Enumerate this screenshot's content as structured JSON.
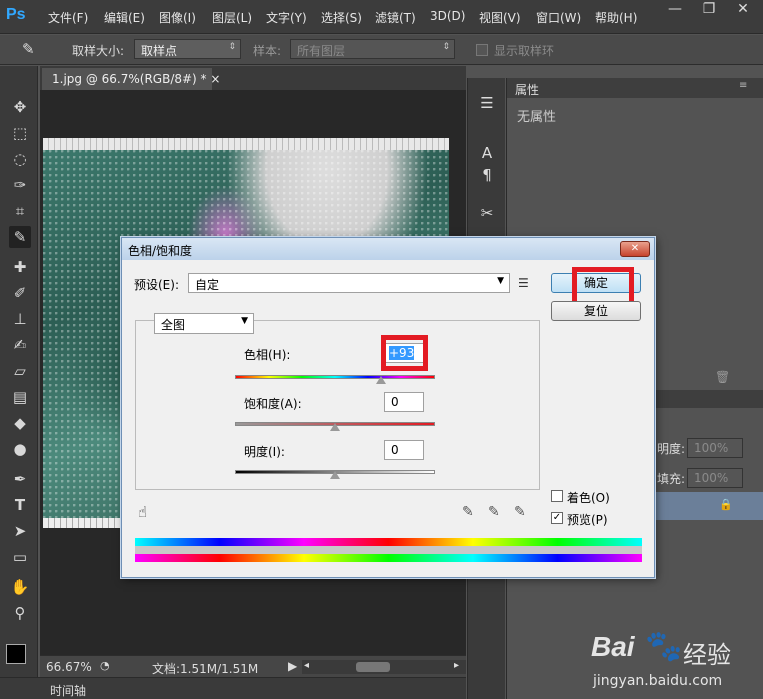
{
  "app": {
    "logo": "Ps"
  },
  "menubar": {
    "items": [
      "文件(F)",
      "编辑(E)",
      "图像(I)",
      "图层(L)",
      "文字(Y)",
      "选择(S)",
      "滤镜(T)",
      "3D(D)",
      "视图(V)",
      "窗口(W)",
      "帮助(H)"
    ],
    "window_controls": [
      "—",
      "❐",
      "✕"
    ]
  },
  "options_bar": {
    "sample_size_label": "取样大小:",
    "sample_size_value": "取样点",
    "sample_label": "样本:",
    "sample_value": "所有图层",
    "show_ring_label": "显示取样环"
  },
  "document": {
    "tab_title": "1.jpg @ 66.7%(RGB/8#) *",
    "tab_close": "×"
  },
  "statusbar": {
    "zoom": "66.67%",
    "doc_info": "文档:1.51M/1.51M"
  },
  "timeline": {
    "label": "时间轴"
  },
  "properties_panel": {
    "tab": "属性",
    "content": "无属性"
  },
  "layers_panel": {
    "opacity_label": "明度:",
    "opacity_value": "100%",
    "fill_label": "填充:",
    "fill_value": "100%"
  },
  "dialog": {
    "title": "色相/饱和度",
    "preset_label": "预设(E):",
    "preset_value": "自定",
    "channel_value": "全图",
    "hue_label": "色相(H):",
    "hue_value": "+93",
    "hue_position": 0.73,
    "saturation_label": "饱和度(A):",
    "saturation_value": "0",
    "saturation_position": 0.5,
    "lightness_label": "明度(I):",
    "lightness_value": "0",
    "lightness_position": 0.5,
    "ok_label": "确定",
    "reset_label": "复位",
    "colorize_label": "着色(O)",
    "colorize_checked": false,
    "preview_label": "预览(P)",
    "preview_checked": true,
    "preview_check": "✓"
  },
  "watermark": {
    "brand": "Bai",
    "brand2": "经验",
    "url": "jingyan.baidu.com"
  },
  "colors": {
    "highlight": "#e31b23",
    "ps_blue": "#31a8ff"
  }
}
